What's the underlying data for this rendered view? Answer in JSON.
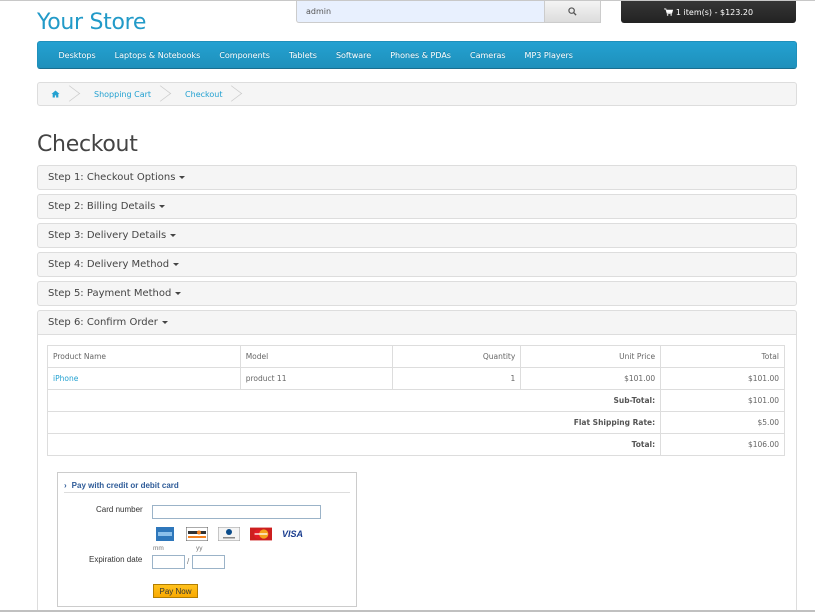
{
  "header": {
    "logo": "Your Store",
    "search_value": "admin",
    "search_icon": "search-icon",
    "cart_label": "1 item(s) - $123.20",
    "cart_icon": "shopping-cart-icon"
  },
  "menu": {
    "items": [
      "Desktops",
      "Laptops & Notebooks",
      "Components",
      "Tablets",
      "Software",
      "Phones & PDAs",
      "Cameras",
      "MP3 Players"
    ]
  },
  "breadcrumb": {
    "home_icon": "home-icon",
    "items": [
      "Shopping Cart",
      "Checkout"
    ]
  },
  "page": {
    "title": "Checkout"
  },
  "steps": [
    "Step 1: Checkout Options",
    "Step 2: Billing Details",
    "Step 3: Delivery Details",
    "Step 4: Delivery Method",
    "Step 5: Payment Method",
    "Step 6: Confirm Order"
  ],
  "order_table": {
    "headers": [
      "Product Name",
      "Model",
      "Quantity",
      "Unit Price",
      "Total"
    ],
    "rows": [
      {
        "product": "iPhone",
        "model": "product 11",
        "quantity": "1",
        "unit_price": "$101.00",
        "total": "$101.00"
      }
    ],
    "totals": [
      {
        "label": "Sub-Total:",
        "value": "$101.00"
      },
      {
        "label": "Flat Shipping Rate:",
        "value": "$5.00"
      },
      {
        "label": "Total:",
        "value": "$106.00"
      }
    ]
  },
  "payment": {
    "header": "Pay with credit or debit card",
    "card_number_label": "Card number",
    "card_number_value": "",
    "card_brands": [
      "American Express",
      "Discover",
      "Diners Club",
      "MasterCard",
      "VISA"
    ],
    "visa_text": "VISA",
    "mm_label": "mm",
    "yy_label": "yy",
    "expiration_label": "Expiration date",
    "separator": "/",
    "pay_button": "Pay Now",
    "accent_color": "#2e5b98",
    "button_color": "#f9a900"
  },
  "colors": {
    "brand": "#229ac8",
    "menu_bg": "#229ac8",
    "link": "#23a1d1"
  }
}
